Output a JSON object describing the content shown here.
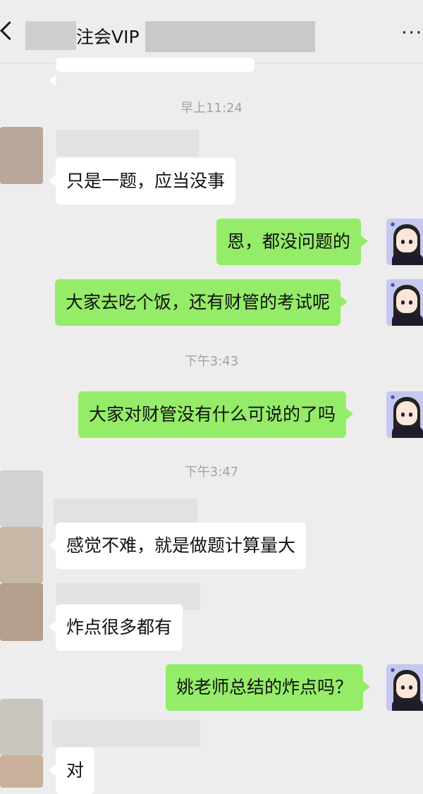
{
  "header": {
    "title": "注会VIP",
    "more": "···"
  },
  "times": [
    "早上11:24",
    "下午3:43",
    "下午3:47"
  ],
  "messages": {
    "m1": "只是一题，应当没事",
    "m2": "恩，都没问题的",
    "m3": "大家去吃个饭，还有财管的考试呢",
    "m4": "大家对财管没有什么可说的了吗",
    "m5": "感觉不难，就是做题计算量大",
    "m6": "炸点很多都有",
    "m7": "姚老师总结的炸点吗？",
    "m8": "对"
  },
  "colors": {
    "background": "#ededed",
    "sent": "#95ec69",
    "received": "#ffffff"
  },
  "icons": {
    "back": "chevron-left-icon",
    "more": "more-dots-icon"
  }
}
